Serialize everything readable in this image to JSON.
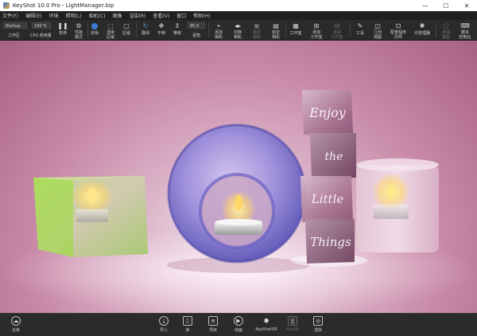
{
  "window": {
    "title": "KeyShot 10.0 Pro  - LightManager.bip",
    "minimize_glyph": "—",
    "maximize_glyph": "☐",
    "close_glyph": "✕"
  },
  "menu": [
    "文件(F)",
    "编辑(E)",
    "环境",
    "照明(L)",
    "相机(C)",
    "图像",
    "渲染(R)",
    "查看(V)",
    "窗口",
    "帮助(H)"
  ],
  "ribbon": {
    "preset_value": "Startup",
    "percent_value": "100 %",
    "angle_value": "85.0",
    "workspace_label": "工作区",
    "cpu_label": "CPU 使用量",
    "pause_label": "暂停",
    "perf_mode_label": "性能\n模式",
    "denoise_label": "去噪",
    "region_label": "渲染\n区域",
    "region2_label": "区域",
    "flip_label": "翻译",
    "pan_label": "平移",
    "push_label": "推移",
    "view_angle_label": "视角",
    "add_camera_label": "添加\n相机",
    "reset_camera_label": "切换\n相机",
    "lock_camera_label": "锁定\n相机",
    "delete_camera_label": "锁定\n相机",
    "studio_label": "工作室",
    "add_studio_label": "添加\n工作室",
    "studio_toggle_label": "添加\n工作室",
    "tools_label": "工具",
    "geometry_view_label": "几何\n视图",
    "config_wizard_label": "配置程序\n向导",
    "light_manager_label": "光管理器",
    "add_model_label": "添加\n模型",
    "script_label": "脚本\n控制台"
  },
  "scene": {
    "cube_text": [
      "Enjoy",
      "the",
      "Little",
      "Things"
    ],
    "colors": {
      "bg_top": "#a76083",
      "bg_floor": "#f3e6ee",
      "green_glass": "#8fd63a",
      "violet_glass": "#7a7ad6",
      "cube_glass": "#b98aa8",
      "flame": "#ffd86b"
    }
  },
  "dock": {
    "cloud_label": "云库",
    "import_label": "导入",
    "library_label": "库",
    "project_label": "项目",
    "animation_label": "动画",
    "keyshotxr_label": "KeyShotXR",
    "keyvr_label": "KeyVR",
    "render_label": "渲染"
  }
}
